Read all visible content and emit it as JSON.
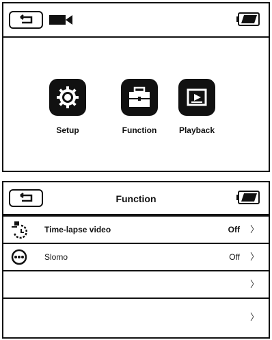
{
  "top_screen": {
    "status_bar": {
      "back_icon": "back-arrow-icon",
      "mode_icon": "video-camera-icon",
      "battery_icon": "battery-icon"
    },
    "menu": [
      {
        "label": "Setup",
        "icon": "gear-icon"
      },
      {
        "label": "Function",
        "icon": "toolbox-icon"
      },
      {
        "label": "Playback",
        "icon": "playback-icon"
      }
    ]
  },
  "bottom_screen": {
    "header": {
      "title": "Function",
      "back_icon": "back-arrow-icon",
      "battery_icon": "battery-icon"
    },
    "items": [
      {
        "label": "Time-lapse video",
        "value": "Off",
        "icon": "time-lapse-icon",
        "chevron": "〉"
      },
      {
        "label": "Slomo",
        "value": "Off",
        "icon": "slomo-icon",
        "chevron": "〉"
      },
      {
        "label": "",
        "value": "",
        "chevron": "〉"
      },
      {
        "label": "",
        "value": "",
        "chevron": "〉"
      }
    ]
  }
}
